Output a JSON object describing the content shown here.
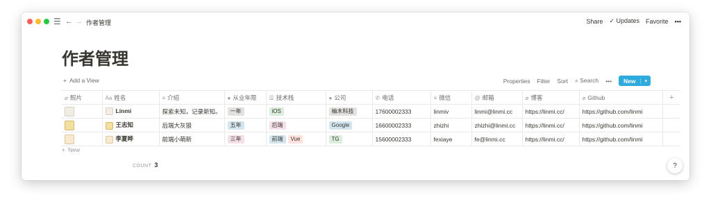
{
  "breadcrumb": "作者管理",
  "topbar": {
    "share": "Share",
    "updates": "Updates",
    "favorite": "Favorite",
    "more": "•••"
  },
  "page_title": "作者管理",
  "toolbar": {
    "add_view": "Add a View",
    "properties": "Properties",
    "filter": "Filter",
    "sort": "Sort",
    "search": "Search",
    "more": "•••",
    "new": "New"
  },
  "columns": [
    {
      "icon": "⌀",
      "label": "照片"
    },
    {
      "icon": "Aa",
      "label": "姓名"
    },
    {
      "icon": "≡",
      "label": "介绍"
    },
    {
      "icon": "●",
      "label": "从业年限"
    },
    {
      "icon": "☰",
      "label": "技术栈"
    },
    {
      "icon": "●",
      "label": "公司"
    },
    {
      "icon": "✆",
      "label": "电话"
    },
    {
      "icon": "≡",
      "label": "微信"
    },
    {
      "icon": "@",
      "label": "邮箱"
    },
    {
      "icon": "⌀",
      "label": "博客"
    },
    {
      "icon": "⌀",
      "label": "Github"
    }
  ],
  "rows": [
    {
      "name": "Linmi",
      "intro": "探索未知，记录新知。",
      "years": "一年",
      "stack": [
        "iOS"
      ],
      "company": "柚木科技",
      "phone": "17600002333",
      "wechat": "linmiv",
      "email": "linmi@linmi.cc",
      "blog": "https://linmi.cc/",
      "github": "https://github.com/linmi"
    },
    {
      "name": "王志知",
      "intro": "后端大灰狼",
      "years": "五年",
      "stack": [
        "后端"
      ],
      "company": "Google",
      "phone": "16600002333",
      "wechat": "zhizhi",
      "email": "zhizhi@linmi.cc",
      "blog": "https://linmi.cc/",
      "github": "https://github.com/linmi"
    },
    {
      "name": "李夏晔",
      "intro": "前端小萌新",
      "years": "三年",
      "stack": [
        "前端",
        "Vue"
      ],
      "company": "TG",
      "phone": "15600002333",
      "wechat": "fexiaye",
      "email": "fe@linmi.cc",
      "blog": "https://linmi.cc/",
      "github": "https://github.com/linmi"
    }
  ],
  "new_row": "New",
  "count_label": "COUNT",
  "count_value": "3",
  "help": "?"
}
